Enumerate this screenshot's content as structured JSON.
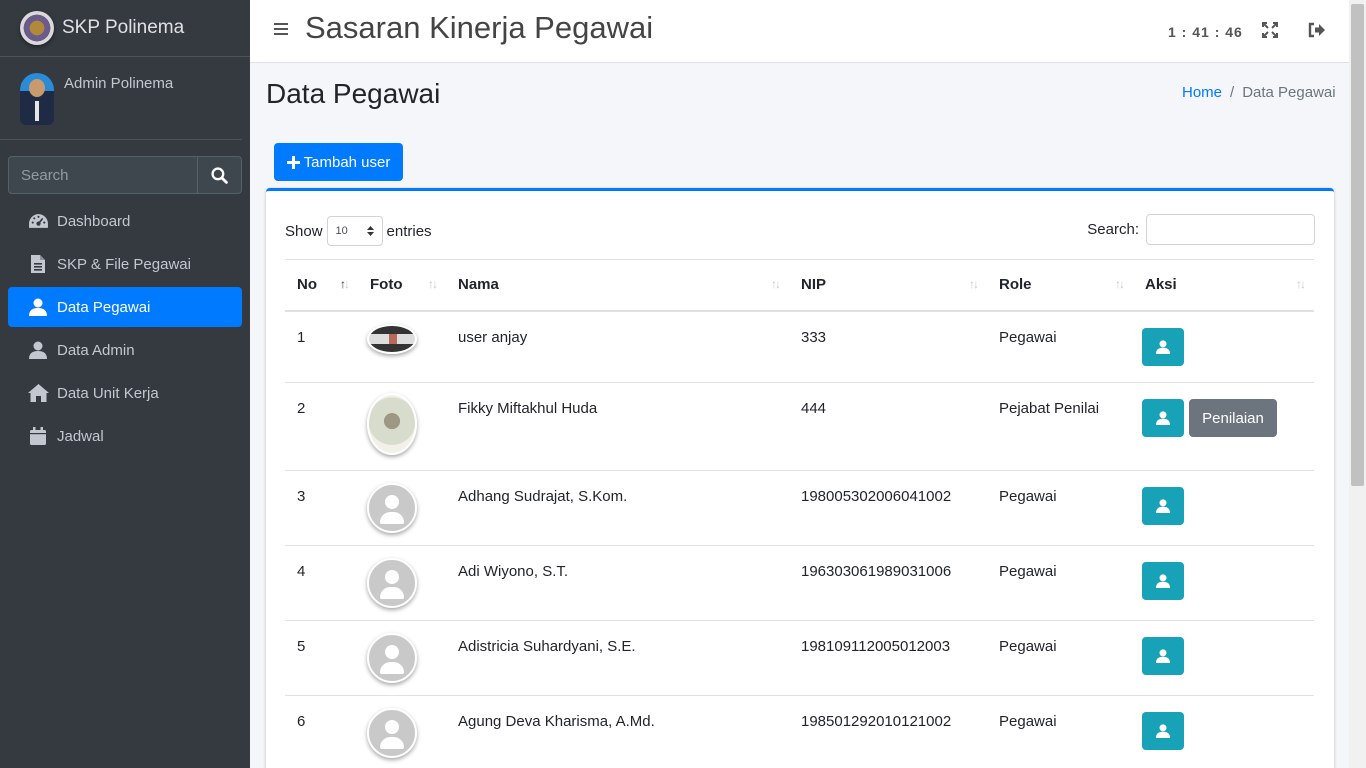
{
  "brand": {
    "name": "SKP Polinema"
  },
  "user": {
    "name": "Admin Polinema"
  },
  "sidebar_search": {
    "placeholder": "Search"
  },
  "sidebar": {
    "items": [
      {
        "label": "Dashboard",
        "icon": "dashboard-icon"
      },
      {
        "label": "SKP & File Pegawai",
        "icon": "file-icon"
      },
      {
        "label": "Data Pegawai",
        "icon": "user-icon",
        "active": true
      },
      {
        "label": "Data Admin",
        "icon": "user-icon"
      },
      {
        "label": "Data Unit Kerja",
        "icon": "home-icon"
      },
      {
        "label": "Jadwal",
        "icon": "calendar-icon"
      }
    ]
  },
  "header": {
    "title": "Sasaran Kinerja Pegawai",
    "clock": "1 : 41 : 46"
  },
  "page": {
    "title": "Data Pegawai",
    "breadcrumb": {
      "home": "Home",
      "current": "Data Pegawai"
    },
    "add_button": "Tambah user"
  },
  "table_controls": {
    "show_label": "Show",
    "entries_value": "10",
    "entries_label": "entries",
    "search_label": "Search:"
  },
  "table": {
    "columns": [
      "No",
      "Foto",
      "Nama",
      "NIP",
      "Role",
      "Aksi"
    ],
    "rows": [
      {
        "no": "1",
        "nama": "user anjay",
        "nip": "333",
        "role": "Pegawai",
        "penilaian": false
      },
      {
        "no": "2",
        "nama": "Fikky Miftakhul Huda",
        "nip": "444",
        "role": "Pejabat Penilai",
        "penilaian": true
      },
      {
        "no": "3",
        "nama": "Adhang Sudrajat, S.Kom.",
        "nip": "198005302006041002",
        "role": "Pegawai",
        "penilaian": false
      },
      {
        "no": "4",
        "nama": "Adi Wiyono, S.T.",
        "nip": "196303061989031006",
        "role": "Pegawai",
        "penilaian": false
      },
      {
        "no": "5",
        "nama": "Adistricia Suhardyani, S.E.",
        "nip": "198109112005012003",
        "role": "Pegawai",
        "penilaian": false
      },
      {
        "no": "6",
        "nama": "Agung Deva Kharisma, A.Md.",
        "nip": "198501292010121002",
        "role": "Pegawai",
        "penilaian": false
      }
    ],
    "penilaian_label": "Penilaian"
  },
  "colors": {
    "primary": "#007bff",
    "info": "#17a2b8",
    "secondary": "#6c757d",
    "sidebar_bg": "#343a40"
  }
}
